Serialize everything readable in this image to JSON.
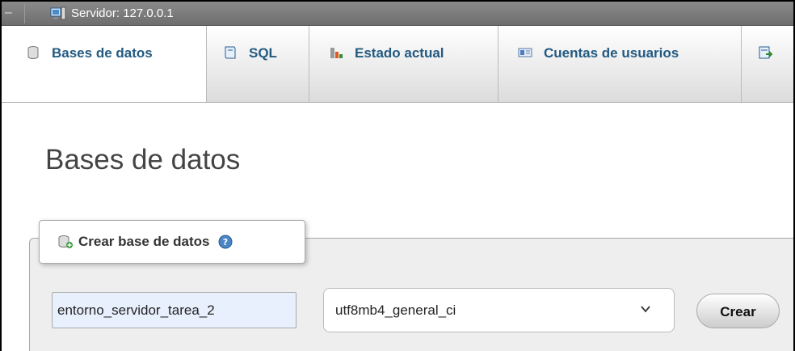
{
  "server_bar": {
    "label": "Servidor: 127.0.0.1",
    "icons": [
      "collapse-dash",
      "server-icon"
    ]
  },
  "tabs": [
    {
      "label": "Bases de datos",
      "icon": "database-icon",
      "active": true
    },
    {
      "label": "SQL",
      "icon": "sql-icon",
      "active": false
    },
    {
      "label": "Estado actual",
      "icon": "status-chart-icon",
      "active": false
    },
    {
      "label": "Cuentas de usuarios",
      "icon": "user-accounts-icon",
      "active": false
    },
    {
      "label": "",
      "icon": "export-icon",
      "active": false
    }
  ],
  "page": {
    "title": "Bases de datos"
  },
  "create_db": {
    "legend": "Crear base de datos",
    "name_value": "entorno_servidor_tarea_2",
    "collation_selected": "utf8mb4_general_ci",
    "create_button": "Crear"
  },
  "colors": {
    "tab_text": "#235a81",
    "server_bar": "#7a7a7a",
    "fieldset_bg": "#eeeeee",
    "input_bg": "#e8f0fe"
  }
}
